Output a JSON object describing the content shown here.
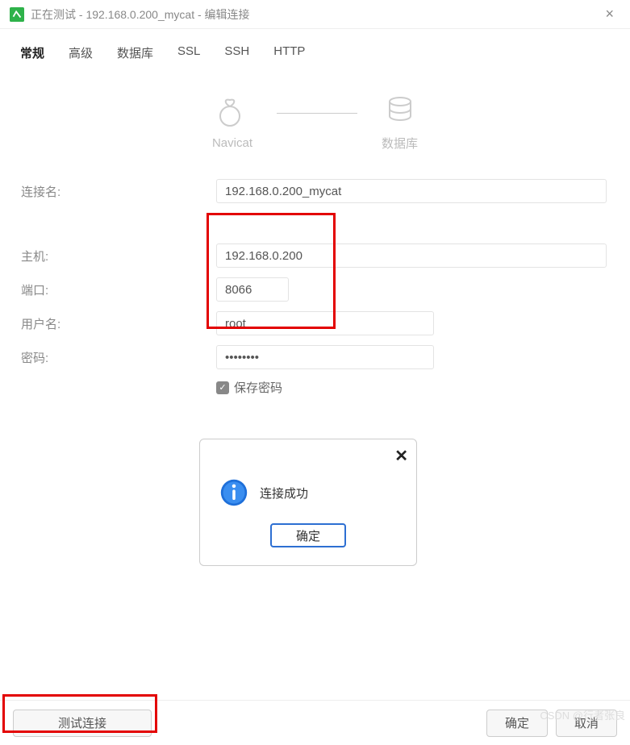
{
  "titlebar": {
    "title": "正在测试 - 192.168.0.200_mycat - 编辑连接"
  },
  "tabs": [
    {
      "label": "常规",
      "active": true
    },
    {
      "label": "高级"
    },
    {
      "label": "数据库"
    },
    {
      "label": "SSL"
    },
    {
      "label": "SSH"
    },
    {
      "label": "HTTP"
    }
  ],
  "diagram": {
    "left": "Navicat",
    "right": "数据库"
  },
  "form": {
    "conn_name_label": "连接名:",
    "conn_name": "192.168.0.200_mycat",
    "host_label": "主机:",
    "host": "192.168.0.200",
    "port_label": "端口:",
    "port": "8066",
    "user_label": "用户名:",
    "user": "root",
    "pass_label": "密码:",
    "pass": "••••••••",
    "save_pass": "保存密码"
  },
  "modal": {
    "msg": "连接成功",
    "ok": "确定"
  },
  "footer": {
    "test": "测试连接",
    "ok": "确定",
    "cancel": "取消"
  },
  "watermark": "CSDN @行者张良"
}
